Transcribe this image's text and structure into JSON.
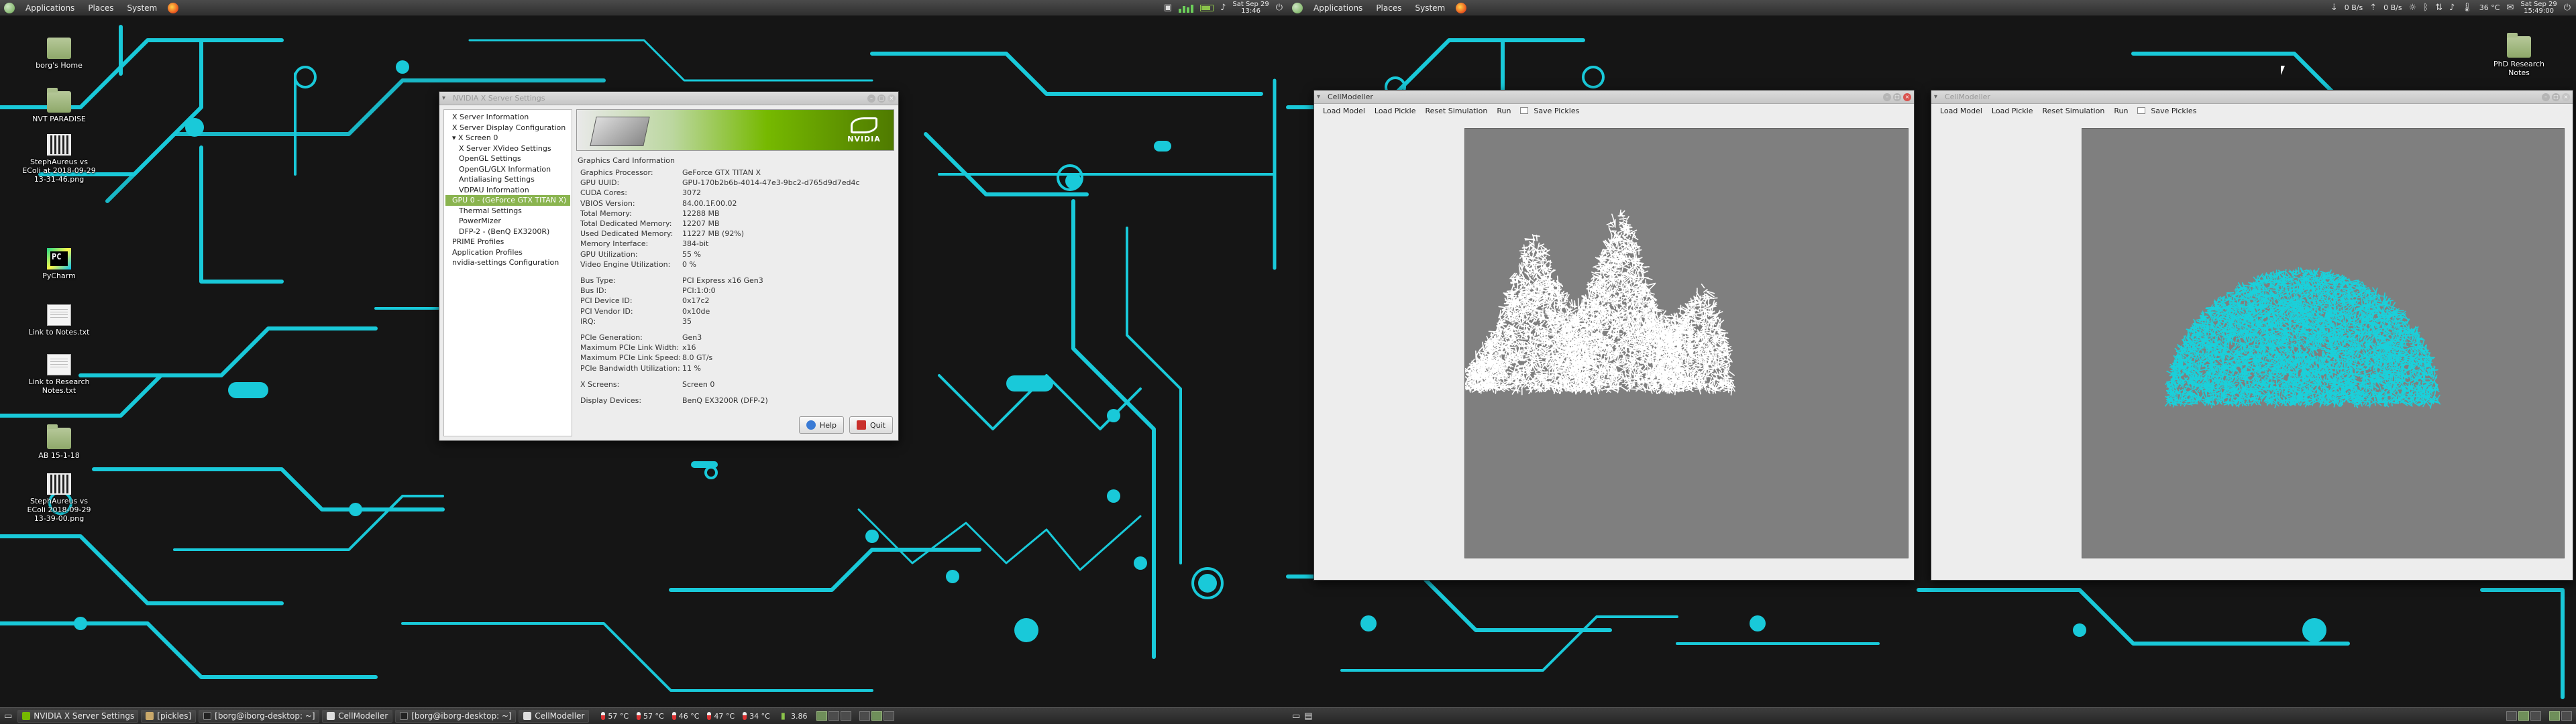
{
  "colors": {
    "circuit": "#19c9d9",
    "background": "#151515",
    "nvidia_green": "#76b900",
    "selection": "#8ab44f",
    "cells_left": "#ffffff",
    "cells_right": "#1ad0da"
  },
  "left_panel": {
    "menu": [
      "Applications",
      "Places",
      "System"
    ],
    "clock_line1": "Sat Sep 29",
    "clock_line2": "13:46"
  },
  "right_panel": {
    "menu": [
      "Applications",
      "Places",
      "System"
    ],
    "net_down": "0 B/s",
    "net_up": "0 B/s",
    "temperature": "36 °C",
    "clock_line1": "Sat Sep 29",
    "clock_line2": "15:49:00"
  },
  "desktop_icons": [
    {
      "label": "borg's Home",
      "type": "home"
    },
    {
      "label": "NVT PARADISE",
      "type": "folder"
    },
    {
      "label": "StephAureus vs EColi at 2018-09-29 13-31-46.png",
      "type": "film"
    },
    {
      "label": "PyCharm",
      "type": "pycharm"
    },
    {
      "label": "Link to Notes.txt",
      "type": "file"
    },
    {
      "label": "Link to Research Notes.txt",
      "type": "file"
    },
    {
      "label": "AB 15-1-18",
      "type": "folder"
    },
    {
      "label": "StephAureus vs EColi 2018-09-29 13-39-00.png",
      "type": "film"
    },
    {
      "label": "PhD Research Notes",
      "type": "folder"
    }
  ],
  "nvidia": {
    "window_title": "NVIDIA X Server Settings",
    "tree": [
      {
        "label": "X Server Information",
        "level": 0
      },
      {
        "label": "X Server Display Configuration",
        "level": 0
      },
      {
        "label": "▾ X Screen 0",
        "level": 0
      },
      {
        "label": "X Server XVideo Settings",
        "level": 1
      },
      {
        "label": "OpenGL Settings",
        "level": 1
      },
      {
        "label": "OpenGL/GLX Information",
        "level": 1
      },
      {
        "label": "Antialiasing Settings",
        "level": 1
      },
      {
        "label": "VDPAU Information",
        "level": 1
      },
      {
        "label": "GPU 0 - (GeForce GTX TITAN X)",
        "level": 0,
        "selected": true
      },
      {
        "label": "Thermal Settings",
        "level": 1
      },
      {
        "label": "PowerMizer",
        "level": 1
      },
      {
        "label": "DFP-2 - (BenQ EX3200R)",
        "level": 1
      },
      {
        "label": "PRIME Profiles",
        "level": 0
      },
      {
        "label": "Application Profiles",
        "level": 0
      },
      {
        "label": "nvidia-settings Configuration",
        "level": 0
      }
    ],
    "section_title": "Graphics Card Information",
    "info_groups": [
      [
        [
          "Graphics Processor:",
          "GeForce GTX TITAN X"
        ],
        [
          "GPU UUID:",
          "GPU-170b2b6b-4014-47e3-9bc2-d765d9d7ed4c"
        ],
        [
          "CUDA Cores:",
          "3072"
        ],
        [
          "VBIOS Version:",
          "84.00.1F.00.02"
        ],
        [
          "Total Memory:",
          "12288 MB"
        ],
        [
          "Total Dedicated Memory:",
          "12207 MB"
        ],
        [
          "Used Dedicated Memory:",
          "11227 MB (92%)"
        ],
        [
          "Memory Interface:",
          "384-bit"
        ],
        [
          "GPU Utilization:",
          "55 %"
        ],
        [
          "Video Engine Utilization:",
          "0 %"
        ]
      ],
      [
        [
          "Bus Type:",
          "PCI Express x16 Gen3"
        ],
        [
          "Bus ID:",
          "PCI:1:0:0"
        ],
        [
          "PCI Device ID:",
          "0x17c2"
        ],
        [
          "PCI Vendor ID:",
          "0x10de"
        ],
        [
          "IRQ:",
          "35"
        ]
      ],
      [
        [
          "PCIe Generation:",
          "Gen3"
        ],
        [
          "Maximum PCIe Link Width:",
          "x16"
        ],
        [
          "Maximum PCIe Link Speed:",
          "8.0 GT/s"
        ],
        [
          "PCIe Bandwidth Utilization:",
          "11 %"
        ]
      ],
      [
        [
          "X Screens:",
          "Screen 0"
        ]
      ],
      [
        [
          "Display Devices:",
          "BenQ EX3200R (DFP-2)"
        ]
      ]
    ],
    "help_label": "Help",
    "quit_label": "Quit",
    "banner_logo": "NVIDIA"
  },
  "cellmodeller_left": {
    "title": "CellModeller",
    "menu": [
      "Load Model",
      "Load Pickle",
      "Reset Simulation",
      "Run",
      "Save Pickles"
    ]
  },
  "cellmodeller_right": {
    "title": "CellModeller",
    "menu": [
      "Load Model",
      "Load Pickle",
      "Reset Simulation",
      "Run",
      "Save Pickles"
    ]
  },
  "taskbar_left": {
    "tasks": [
      {
        "label": "NVIDIA X Server Settings",
        "icon": "green"
      },
      {
        "label": "[pickles]",
        "icon": "folder"
      },
      {
        "label": "[borg@iborg-desktop: ~]",
        "icon": "term"
      },
      {
        "label": "CellModeller",
        "icon": "win"
      },
      {
        "label": "[borg@iborg-desktop: ~]",
        "icon": "term"
      },
      {
        "label": "CellModeller",
        "icon": "win"
      }
    ],
    "temps": [
      "57 °C",
      "57 °C",
      "46 °C",
      "47 °C",
      "34 °C"
    ],
    "load": "3.86"
  }
}
